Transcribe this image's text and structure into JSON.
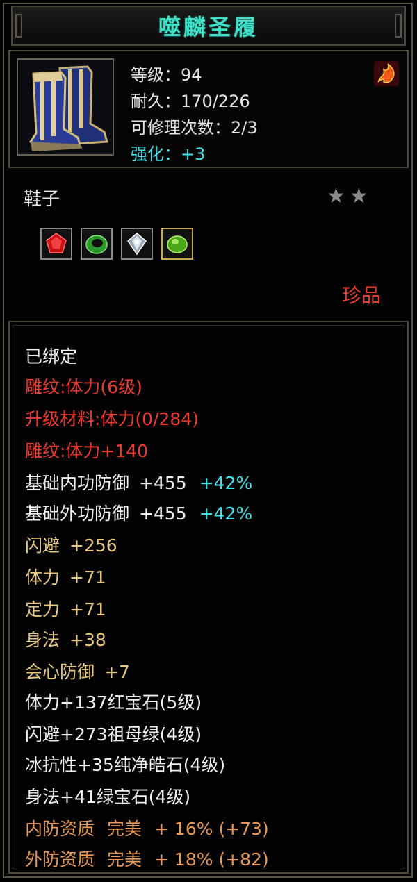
{
  "title": "噬麟圣履",
  "head": {
    "level": "等级：94",
    "durability": "耐久：170/226",
    "repairs": "可修理次数：2/3",
    "enhance": "强化：+3",
    "icon_name": "boots-icon",
    "corner_icon_name": "fire-emblem-icon"
  },
  "item_type": "鞋子",
  "stars": [
    "★",
    "★"
  ],
  "gems": [
    {
      "name": "ruby-gem-icon",
      "color": "#d01818"
    },
    {
      "name": "jade-ring-icon",
      "color": "#2aa82a"
    },
    {
      "name": "diamond-gem-icon",
      "color": "#b8c8d8"
    },
    {
      "name": "green-gem-icon",
      "color": "#58c020"
    }
  ],
  "rarity": "珍品",
  "attributes": {
    "bound": "已绑定",
    "carve1": "雕纹:体力(6级)",
    "upgrade_mat": "升级材料:体力(0/284)",
    "carve2": "雕纹:体力+140",
    "inner_def": {
      "label": "基础内功防御",
      "value": "+455",
      "pct": "+42%"
    },
    "outer_def": {
      "label": "基础外功防御",
      "value": "+455",
      "pct": "+42%"
    },
    "dodge": {
      "label": "闪避",
      "value": "+256"
    },
    "stamina": {
      "label": "体力",
      "value": "+71"
    },
    "focus": {
      "label": "定力",
      "value": "+71"
    },
    "agility": {
      "label": "身法",
      "value": "+38"
    },
    "crit_def": {
      "label": "会心防御",
      "value": "+7"
    },
    "gem1": "体力+137红宝石(5级)",
    "gem2": "闪避+273祖母绿(4级)",
    "gem3": "冰抗性+35纯净皓石(4级)",
    "gem4": "身法+41绿宝石(4级)",
    "inner_quality": {
      "label": "内防资质",
      "grade": "完美",
      "value": "+ 16% (+73)"
    },
    "outer_quality": {
      "label": "外防资质",
      "grade": "完美",
      "value": "+ 18% (+82)"
    }
  },
  "colors": {
    "title": "#3fe0c8",
    "cyan": "#44e0e8",
    "red": "#f03a30",
    "gold": "#e6c882",
    "orange": "#e89a58",
    "rarity": "#e83a2a"
  }
}
